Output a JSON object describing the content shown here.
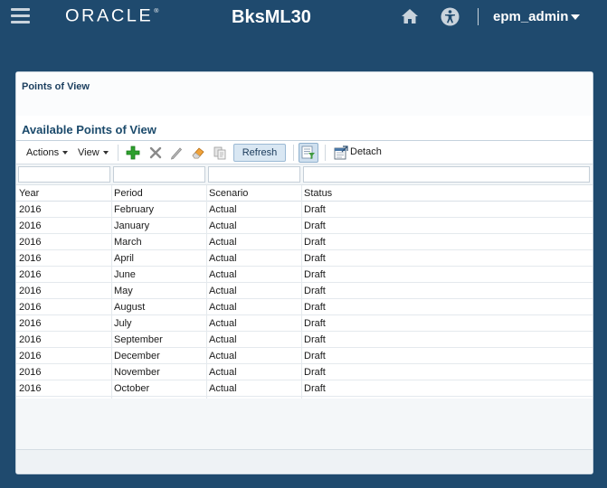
{
  "header": {
    "logo": "ORACLE",
    "logo_mark": "®",
    "app_title": "BksML30",
    "user": "epm_admin"
  },
  "panel": {
    "title": "Points of View",
    "section_title": "Available Points of View"
  },
  "toolbar": {
    "actions_label": "Actions",
    "view_label": "View",
    "refresh_label": "Refresh",
    "detach_label": "Detach",
    "icons": [
      "add-icon",
      "delete-icon",
      "edit-icon",
      "eraser-icon",
      "copy-icon",
      "query-by-example-icon",
      "detach-icon"
    ]
  },
  "table": {
    "columns": [
      "Year",
      "Period",
      "Scenario",
      "Status"
    ],
    "rows": [
      [
        "2016",
        "February",
        "Actual",
        "Draft"
      ],
      [
        "2016",
        "January",
        "Actual",
        "Draft"
      ],
      [
        "2016",
        "March",
        "Actual",
        "Draft"
      ],
      [
        "2016",
        "April",
        "Actual",
        "Draft"
      ],
      [
        "2016",
        "June",
        "Actual",
        "Draft"
      ],
      [
        "2016",
        "May",
        "Actual",
        "Draft"
      ],
      [
        "2016",
        "August",
        "Actual",
        "Draft"
      ],
      [
        "2016",
        "July",
        "Actual",
        "Draft"
      ],
      [
        "2016",
        "September",
        "Actual",
        "Draft"
      ],
      [
        "2016",
        "December",
        "Actual",
        "Draft"
      ],
      [
        "2016",
        "November",
        "Actual",
        "Draft"
      ],
      [
        "2016",
        "October",
        "Actual",
        "Draft"
      ]
    ]
  },
  "colors": {
    "header_bg": "#1f4a6e",
    "section_title": "#1b4a6b",
    "refresh_bg": "#d9e7f3",
    "add_icon": "#2ea02e"
  }
}
